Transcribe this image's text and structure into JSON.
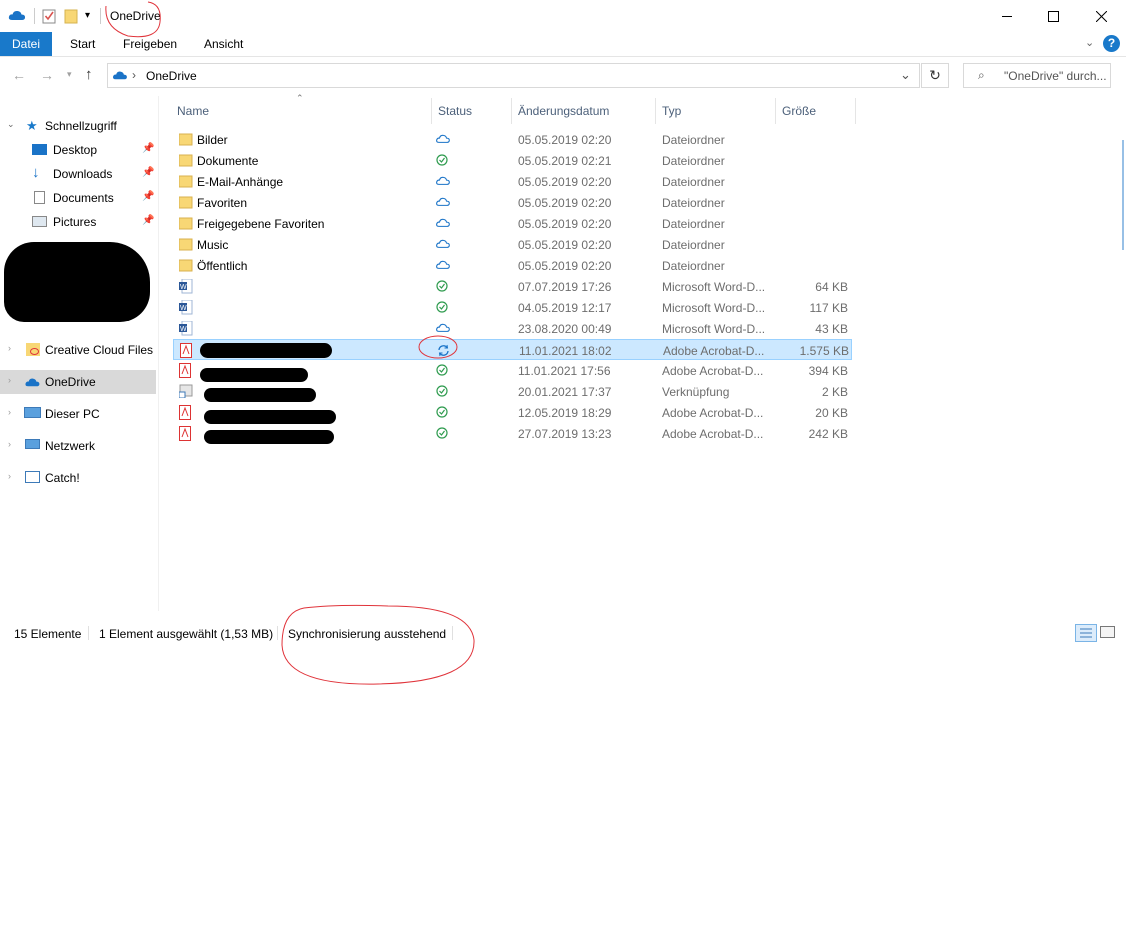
{
  "window": {
    "title": "OneDrive",
    "minimize": "–",
    "maximize": "□",
    "close": "✕"
  },
  "ribbon": {
    "tabs": [
      "Datei",
      "Start",
      "Freigeben",
      "Ansicht"
    ]
  },
  "address": {
    "path": "OneDrive",
    "search_placeholder": "\"OneDrive\" durch..."
  },
  "nav": {
    "quick_access": "Schnellzugriff",
    "quick_items": [
      "Desktop",
      "Downloads",
      "Documents",
      "Pictures"
    ],
    "creative_cloud": "Creative Cloud Files",
    "onedrive": "OneDrive",
    "this_pc": "Dieser PC",
    "network": "Netzwerk",
    "catch": "Catch!"
  },
  "columns": {
    "name": "Name",
    "status": "Status",
    "date": "Änderungsdatum",
    "type": "Typ",
    "size": "Größe"
  },
  "files": [
    {
      "name": "Bilder",
      "status": "cloud",
      "date": "05.05.2019 02:20",
      "type": "Dateiordner",
      "size": "",
      "icon": "folder"
    },
    {
      "name": "Dokumente",
      "status": "check",
      "date": "05.05.2019 02:21",
      "type": "Dateiordner",
      "size": "",
      "icon": "folder"
    },
    {
      "name": "E-Mail-Anhänge",
      "status": "cloud",
      "date": "05.05.2019 02:20",
      "type": "Dateiordner",
      "size": "",
      "icon": "folder"
    },
    {
      "name": "Favoriten",
      "status": "cloud",
      "date": "05.05.2019 02:20",
      "type": "Dateiordner",
      "size": "",
      "icon": "folder"
    },
    {
      "name": "Freigegebene Favoriten",
      "status": "cloud",
      "date": "05.05.2019 02:20",
      "type": "Dateiordner",
      "size": "",
      "icon": "folder"
    },
    {
      "name": "Music",
      "status": "cloud",
      "date": "05.05.2019 02:20",
      "type": "Dateiordner",
      "size": "",
      "icon": "folder"
    },
    {
      "name": "Öffentlich",
      "status": "cloud",
      "date": "05.05.2019 02:20",
      "type": "Dateiordner",
      "size": "",
      "icon": "folder"
    },
    {
      "name": "",
      "status": "check",
      "date": "07.07.2019 17:26",
      "type": "Microsoft Word-D...",
      "size": "64 KB",
      "icon": "word"
    },
    {
      "name": "",
      "status": "check",
      "date": "04.05.2019 12:17",
      "type": "Microsoft Word-D...",
      "size": "117 KB",
      "icon": "word"
    },
    {
      "name": "",
      "status": "cloud",
      "date": "23.08.2020 00:49",
      "type": "Microsoft Word-D...",
      "size": "43 KB",
      "icon": "word"
    },
    {
      "name": "",
      "status": "sync",
      "date": "11.01.2021 18:02",
      "type": "Adobe Acrobat-D...",
      "size": "1.575 KB",
      "icon": "pdf",
      "selected": true
    },
    {
      "name": "",
      "status": "check",
      "date": "11.01.2021 17:56",
      "type": "Adobe Acrobat-D...",
      "size": "394 KB",
      "icon": "pdf"
    },
    {
      "name": "",
      "status": "check",
      "date": "20.01.2021 17:37",
      "type": "Verknüpfung",
      "size": "2 KB",
      "icon": "shortcut"
    },
    {
      "name": "",
      "status": "check",
      "date": "12.05.2019 18:29",
      "type": "Adobe Acrobat-D...",
      "size": "20 KB",
      "icon": "pdf"
    },
    {
      "name": "",
      "status": "check",
      "date": "27.07.2019 13:23",
      "type": "Adobe Acrobat-D...",
      "size": "242 KB",
      "icon": "pdf"
    }
  ],
  "statusbar": {
    "count": "15 Elemente",
    "selected": "1 Element ausgewählt (1,53 MB)",
    "sync": "Synchronisierung ausstehend"
  },
  "colors": {
    "accent": "#1979ca",
    "cloud": "#1a73c7",
    "ok": "#2e9b4e",
    "folder": "#f8d775",
    "annotation": "#e0333a"
  }
}
